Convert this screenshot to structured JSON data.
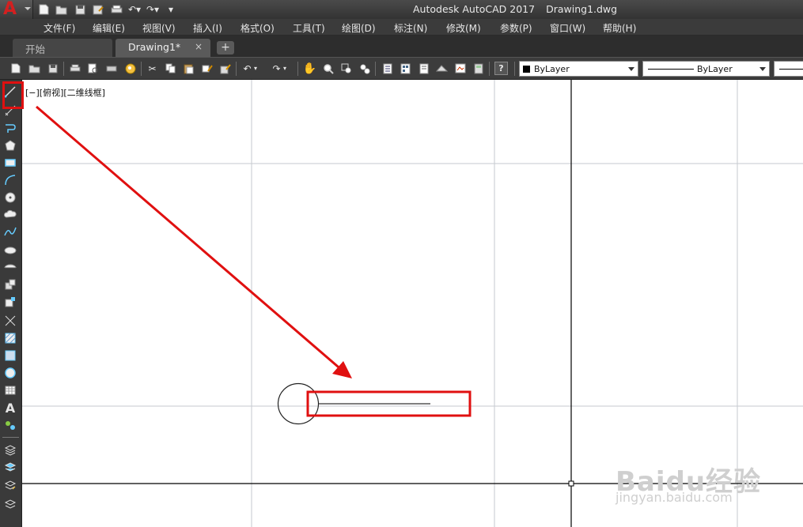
{
  "title": {
    "app": "Autodesk AutoCAD 2017",
    "file": "Drawing1.dwg"
  },
  "app_button": {
    "logo": "A"
  },
  "quick_access": [
    "new-icon",
    "open-icon",
    "save-icon",
    "save-as-icon",
    "print-icon",
    "undo-icon",
    "redo-icon",
    "customize-icon"
  ],
  "menus": [
    "文件(F)",
    "编辑(E)",
    "视图(V)",
    "插入(I)",
    "格式(O)",
    "工具(T)",
    "绘图(D)",
    "标注(N)",
    "修改(M)",
    "参数(P)",
    "窗口(W)",
    "帮助(H)"
  ],
  "tabs": {
    "start": "开始",
    "drawing": "Drawing1*",
    "close": "×",
    "add": "+"
  },
  "toolbar": {
    "color_dropdown": "ByLayer",
    "linetype_dropdown": "ByLayer"
  },
  "viewport_label": "[−][俯视][二维线框]",
  "draw_toolbar": [
    "line-icon",
    "construction-line-icon",
    "polyline-icon",
    "polygon-icon",
    "rectangle-icon",
    "arc-icon",
    "circle-icon",
    "revision-cloud-icon",
    "spline-icon",
    "ellipse-icon",
    "ellipse-arc-icon",
    "insert-block-icon",
    "make-block-icon",
    "point-icon",
    "hatch-icon",
    "gradient-icon",
    "region-icon",
    "table-icon",
    "multiline-text-icon",
    "add-selected-icon"
  ],
  "annotation_colors": {
    "highlight": "#e01010"
  },
  "watermark": {
    "brand": "Baidu经验",
    "url": "jingyan.baidu.com"
  }
}
